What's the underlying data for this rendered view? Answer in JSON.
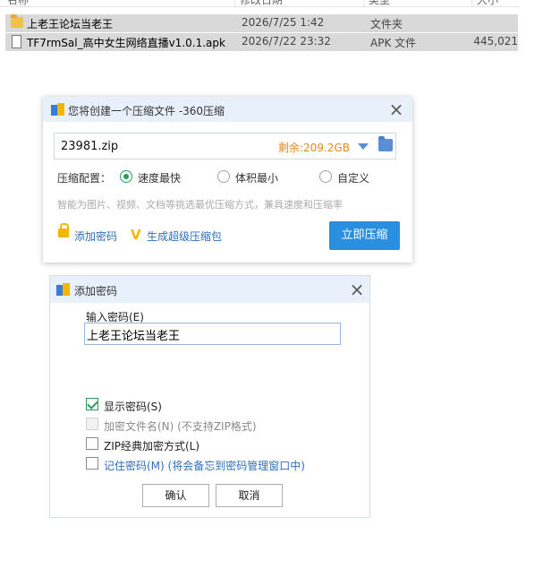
{
  "explorer": {
    "columns": [
      "名称",
      "修改日期",
      "类型",
      "大小"
    ],
    "files": [
      {
        "name": "上老王论坛当老王",
        "date": "2026/7/25 1:42",
        "type": "文件夹",
        "size": "",
        "icon": "folder-icon"
      },
      {
        "name": "TF7rmSal_高中女生网络直播v1.0.1.apk",
        "date": "2026/7/22 23:32",
        "type": "APK 文件",
        "size": "445,021",
        "icon": "file-icon"
      }
    ]
  },
  "compress_dialog": {
    "title": "您将创建一个压缩文件 -360压缩",
    "archive_name": "23981.zip",
    "free_space": "剩余:209.2GB",
    "config_label": "压缩配置：",
    "options": [
      {
        "label": "速度最快",
        "selected": true
      },
      {
        "label": "体积最小",
        "selected": false
      },
      {
        "label": "自定义",
        "selected": false
      }
    ],
    "hint": "智能为图片、视频、文档等挑选最优压缩方式，兼具速度和压缩率",
    "add_password_link": "添加密码",
    "super_pack_link": "生成超级压缩包",
    "compress_button": "立即压缩"
  },
  "password_dialog": {
    "title": "添加密码",
    "input_label": "输入密码(E)",
    "password_value": "上老王论坛当老王",
    "checkboxes": [
      {
        "label": "显示密码(S)",
        "checked": true,
        "disabled": false
      },
      {
        "label": "加密文件名(N) (不支持ZIP格式)",
        "checked": false,
        "disabled": true
      },
      {
        "label": "ZIP经典加密方式(L)",
        "checked": false,
        "disabled": false
      },
      {
        "label": "记住密码(M) (将会备忘到密码管理窗口中)",
        "checked": false,
        "disabled": false
      }
    ],
    "ok_button": "确认",
    "cancel_button": "取消"
  },
  "colors": {
    "accent": "#2b8fe0",
    "warning": "#e48a1e",
    "check_green": "#2c9a5a",
    "link_blue": "#2f6fba"
  }
}
